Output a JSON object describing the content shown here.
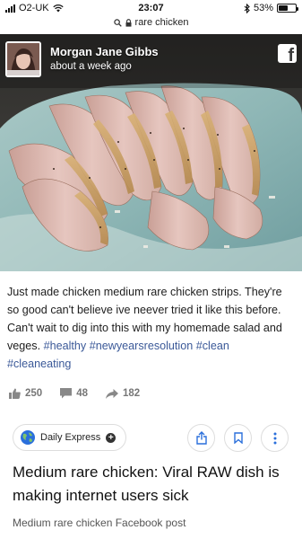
{
  "status_bar": {
    "carrier": "O2-UK",
    "time": "23:07",
    "battery_percent": "53%",
    "battery_level": 0.53
  },
  "address_bar": {
    "query": "rare chicken"
  },
  "post": {
    "author": "Morgan Jane Gibbs",
    "time": "about a week ago",
    "caption": "Just made chicken medium rare chicken strips. They're so good can't believe ive neever tried it like this before. Can't wait to dig into this with my homemade salad and veges.",
    "hashtags": "#healthy #newyearsresolution #clean #cleaneating",
    "likes": "250",
    "comments": "48",
    "shares": "182"
  },
  "source": {
    "name": "Daily Express"
  },
  "article": {
    "headline": "Medium rare chicken: Viral RAW dish is making internet users sick",
    "subtitle": "Medium rare chicken Facebook post"
  },
  "colors": {
    "hashtag": "#3b5998",
    "reaction_text": "#777777",
    "accent_blue": "#2a6fdb"
  }
}
